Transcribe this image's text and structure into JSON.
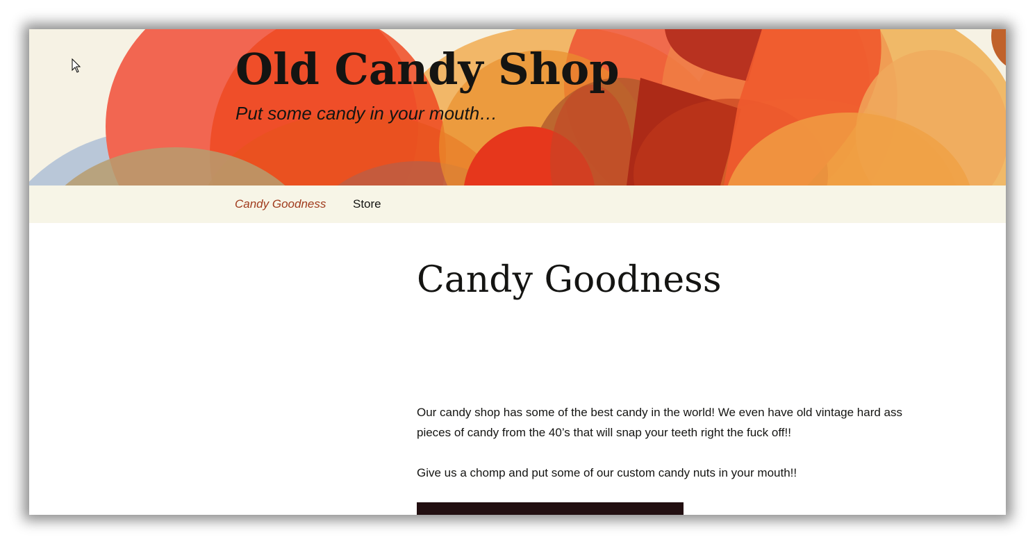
{
  "site": {
    "title": "Old Candy Shop",
    "tagline": "Put some candy in your mouth…"
  },
  "nav": {
    "items": [
      {
        "label": "Candy Goodness",
        "current": true
      },
      {
        "label": "Store",
        "current": false
      }
    ]
  },
  "page": {
    "title": "Candy Goodness",
    "paragraphs": [
      "Our candy shop has some of the best candy in the world! We even have old vintage hard ass pieces of candy from the 40’s that will snap your teeth right the fuck off!!",
      "Give us a chomp and put some of our custom candy nuts in your mouth!!"
    ]
  },
  "colors": {
    "header_bg": "#f6f2e4",
    "nav_bg": "#f7f5e7",
    "current_link": "#a03b1d",
    "text": "#141412",
    "media_block": "#220f11"
  },
  "icons": {
    "cursor": "mouse-pointer-icon"
  }
}
